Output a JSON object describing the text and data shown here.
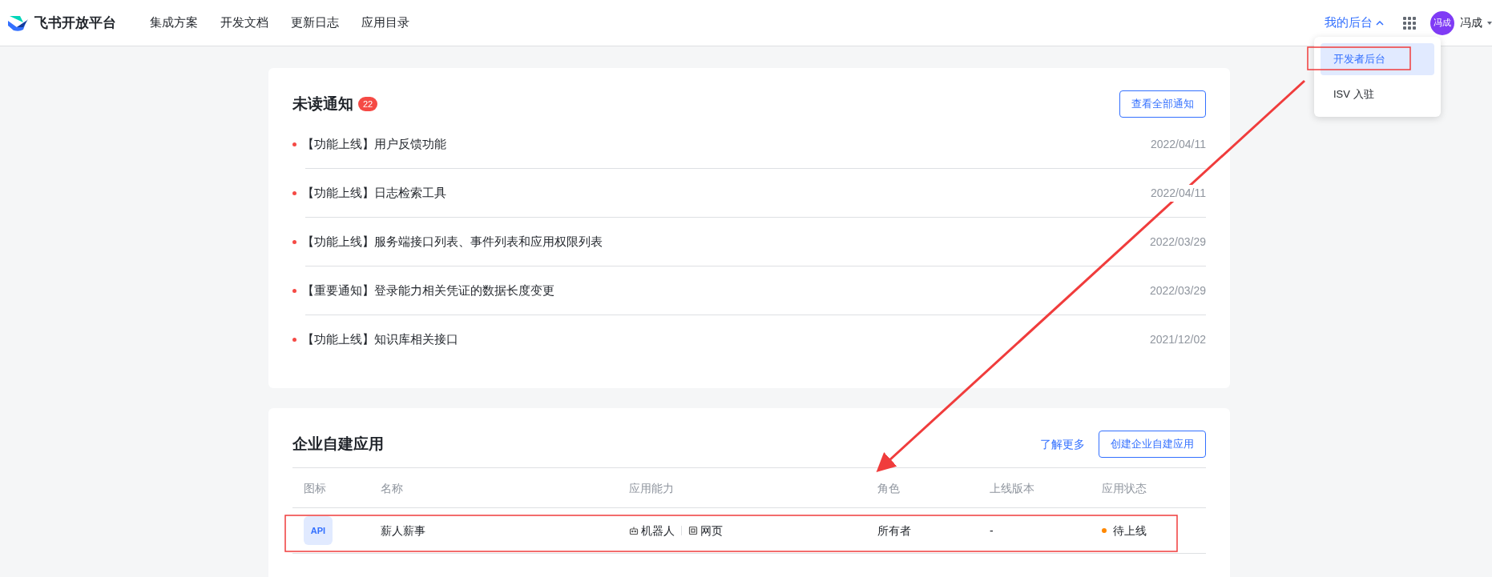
{
  "header": {
    "brand": "飞书开放平台",
    "nav": [
      {
        "label": "集成方案"
      },
      {
        "label": "开发文档"
      },
      {
        "label": "更新日志"
      },
      {
        "label": "应用目录"
      }
    ],
    "console": {
      "label": "我的后台",
      "expanded": true
    },
    "avatar": "冯成",
    "user": "冯成"
  },
  "dropdown": [
    {
      "label": "开发者后台",
      "selected": true
    },
    {
      "label": "ISV 入驻",
      "selected": false
    }
  ],
  "notifications": {
    "title": "未读通知",
    "count": "22",
    "view_all": "查看全部通知",
    "items": [
      {
        "title": "【功能上线】用户反馈功能",
        "date": "2022/04/11"
      },
      {
        "title": "【功能上线】日志检索工具",
        "date": "2022/04/11"
      },
      {
        "title": "【功能上线】服务端接口列表、事件列表和应用权限列表",
        "date": "2022/03/29"
      },
      {
        "title": "【重要通知】登录能力相关凭证的数据长度变更",
        "date": "2022/03/29"
      },
      {
        "title": "【功能上线】知识库相关接口",
        "date": "2021/12/02"
      }
    ]
  },
  "apps": {
    "title": "企业自建应用",
    "learn_more": "了解更多",
    "create": "创建企业自建应用",
    "columns": [
      "图标",
      "名称",
      "应用能力",
      "角色",
      "上线版本",
      "应用状态"
    ],
    "rows": [
      {
        "icon": "API",
        "name": "薪人薪事",
        "abilities": [
          {
            "kind": "bot",
            "label": "机器人"
          },
          {
            "kind": "web",
            "label": "网页"
          }
        ],
        "role": "所有者",
        "version": "-",
        "status": "待上线",
        "color": "#ff8800"
      }
    ]
  }
}
